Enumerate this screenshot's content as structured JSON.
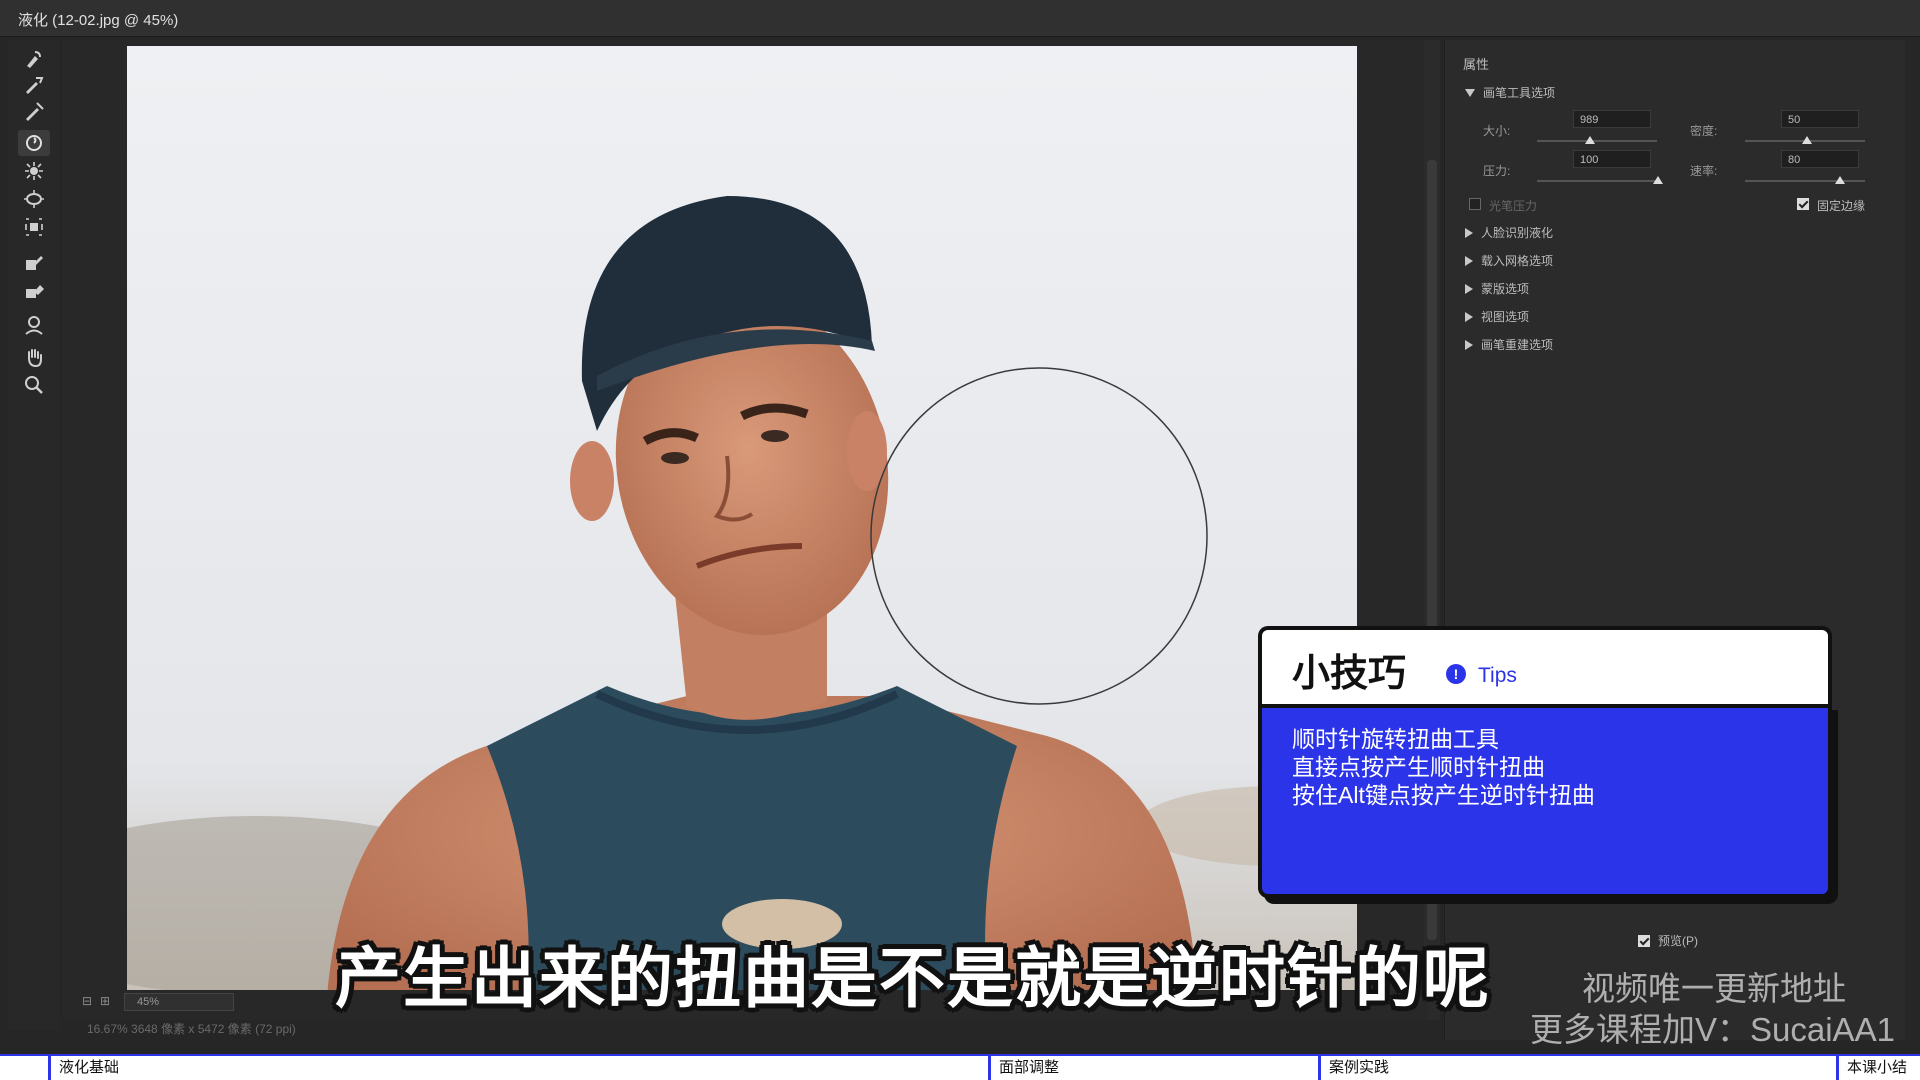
{
  "window": {
    "title": "液化 (12-02.jpg @ 45%)"
  },
  "tools": [
    "forward-warp-icon",
    "reconstruct-icon",
    "smooth-icon",
    "twirl-clockwise-icon",
    "pucker-icon",
    "bloat-icon",
    "push-left-icon",
    "freeze-mask-icon",
    "thaw-mask-icon",
    "face-tool-icon",
    "hand-icon",
    "zoom-icon"
  ],
  "panel": {
    "title": "属性",
    "brush_section": "画笔工具选项",
    "size_label": "大小:",
    "size_value": "989",
    "density_label": "密度:",
    "density_value": "50",
    "pressure_label": "压力:",
    "pressure_value": "100",
    "rate_label": "速率:",
    "rate_value": "80",
    "stylus_label": "光笔压力",
    "pin_edges_label": "固定边缘",
    "sections": [
      "人脸识别液化",
      "载入网格选项",
      "蒙版选项",
      "视图选项",
      "画笔重建选项"
    ],
    "preview_label": "预览(P)"
  },
  "canvas": {
    "zoom": "45%",
    "status_info": "16.67%    3648 像素 x 5472 像素 (72 ppi)"
  },
  "tips": {
    "title": "小技巧",
    "badge": "!",
    "tag": "Tips",
    "lines": [
      "顺时针旋转扭曲工具",
      "直接点按产生顺时针扭曲",
      "按住Alt键点按产生逆时针扭曲"
    ]
  },
  "subtitle": "产生出来的扭曲是不是就是逆时针的呢",
  "watermark": {
    "line1": "视频唯一更新地址",
    "line2": "更多课程加V：SucaiAA1"
  },
  "chapters": [
    "液化基础",
    "面部调整",
    "案例实践",
    "本课小结"
  ],
  "colors": {
    "accent": "#2b34e8",
    "panel_bg": "#2b2b2b"
  }
}
